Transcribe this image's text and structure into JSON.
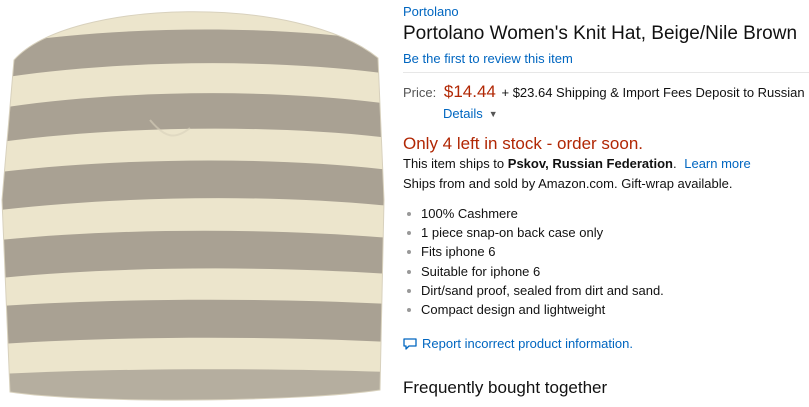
{
  "brand": "Portolano",
  "title": "Portolano Women's Knit Hat, Beige/Nile Brown",
  "review_link": "Be the first to review this item",
  "price": {
    "label": "Price:",
    "value": "$14.44",
    "shipping": "+ $23.64 Shipping & Import Fees Deposit to Russian",
    "details_link": "Details"
  },
  "stock_message": "Only 4 left in stock - order soon.",
  "ships_to": {
    "prefix": "This item ships to",
    "location": "Pskov, Russian Federation",
    "suffix": ".",
    "learn_more": "Learn more"
  },
  "ships_from": "Ships from and sold by Amazon.com. Gift-wrap available.",
  "features": [
    "100% Cashmere",
    "1 piece snap-on back case only",
    "Fits iphone 6",
    "Suitable for iphone 6",
    "Dirt/sand proof, sealed from dirt and sand.",
    "Compact design and lightweight"
  ],
  "report_link": "Report incorrect product information.",
  "frequently_bought_heading": "Frequently bought together",
  "colors": {
    "link": "#0066c0",
    "price": "#b12704",
    "hat_beige": "#ece5cc",
    "hat_brown": "#a9a193"
  },
  "icons": {
    "report": "speech-bubble-icon",
    "details": "caret-down-icon"
  }
}
